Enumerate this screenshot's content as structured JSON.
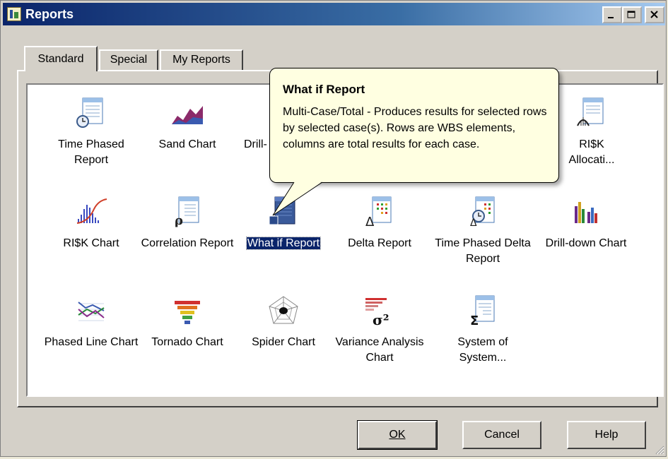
{
  "window": {
    "title": "Reports",
    "icon": "reports-app-icon"
  },
  "tabs": [
    {
      "label": "Standard",
      "active": true
    },
    {
      "label": "Special",
      "active": false
    },
    {
      "label": "My Reports",
      "active": false
    }
  ],
  "reports": [
    {
      "label": "Time Phased Report",
      "icon": "time-phased-report-icon",
      "selected": false
    },
    {
      "label": "Sand Chart",
      "icon": "sand-chart-icon",
      "selected": false
    },
    {
      "label": "Drill-",
      "icon": "drill-report-icon",
      "selected": false
    },
    {
      "label": "RI$K Allocati...",
      "icon": "risk-allocation-icon",
      "selected": false
    },
    {
      "label": "RI$K Chart",
      "icon": "risk-chart-icon",
      "selected": false
    },
    {
      "label": "Correlation Report",
      "icon": "correlation-report-icon",
      "selected": false
    },
    {
      "label": "What if Report",
      "icon": "what-if-report-icon",
      "selected": true
    },
    {
      "label": "Delta Report",
      "icon": "delta-report-icon",
      "selected": false
    },
    {
      "label": "Time Phased Delta Report",
      "icon": "time-phased-delta-report-icon",
      "selected": false
    },
    {
      "label": "Drill-down Chart",
      "icon": "drill-down-chart-icon",
      "selected": false
    },
    {
      "label": "Phased Line Chart",
      "icon": "phased-line-chart-icon",
      "selected": false
    },
    {
      "label": "Tornado Chart",
      "icon": "tornado-chart-icon",
      "selected": false
    },
    {
      "label": "Spider Chart",
      "icon": "spider-chart-icon",
      "selected": false
    },
    {
      "label": "Variance Analysis Chart",
      "icon": "variance-analysis-chart-icon",
      "selected": false
    },
    {
      "label": "System of System...",
      "icon": "system-of-systems-icon",
      "selected": false
    }
  ],
  "tooltip": {
    "title": "What if Report",
    "body": "Multi-Case/Total - Produces results for selected rows by selected case(s). Rows are WBS elements, columns are total results for each case."
  },
  "buttons": {
    "ok": "OK",
    "cancel": "Cancel",
    "help": "Help"
  },
  "colors": {
    "selection": "#0a246a",
    "tooltip_bg": "#ffffe1",
    "titlebar_start": "#0a246a",
    "titlebar_end": "#a6caf0"
  }
}
